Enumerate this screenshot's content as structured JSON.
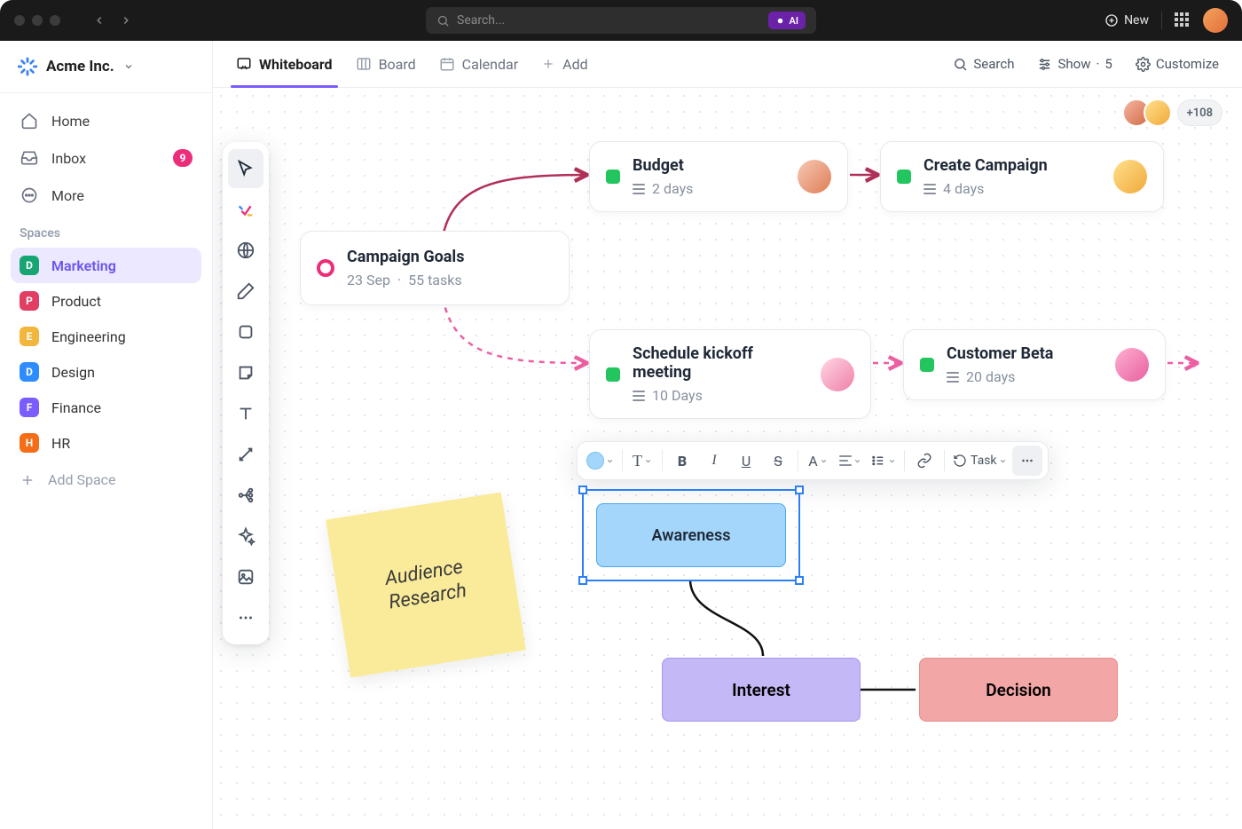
{
  "titlebar": {
    "search_placeholder": "Search...",
    "ai_label": "AI",
    "new_label": "New"
  },
  "workspace": {
    "name": "Acme Inc."
  },
  "sidebar": {
    "nav": {
      "home": "Home",
      "inbox": "Inbox",
      "inbox_count": "9",
      "more": "More"
    },
    "spaces_heading": "Spaces",
    "spaces": [
      {
        "letter": "D",
        "label": "Marketing",
        "color": "#17a673",
        "active": true
      },
      {
        "letter": "P",
        "label": "Product",
        "color": "#e23d63"
      },
      {
        "letter": "E",
        "label": "Engineering",
        "color": "#f2b63c"
      },
      {
        "letter": "D",
        "label": "Design",
        "color": "#2d8cff"
      },
      {
        "letter": "F",
        "label": "Finance",
        "color": "#7b5cff"
      },
      {
        "letter": "H",
        "label": "HR",
        "color": "#f56d17"
      }
    ],
    "add_space": "Add Space"
  },
  "views": {
    "whiteboard": "Whiteboard",
    "board": "Board",
    "calendar": "Calendar",
    "add": "Add",
    "search": "Search",
    "show": "Show",
    "show_count": "5",
    "customize": "Customize"
  },
  "presence": {
    "more": "+108"
  },
  "cards": {
    "goals": {
      "title": "Campaign Goals",
      "date": "23 Sep",
      "tasks": "55 tasks"
    },
    "budget": {
      "title": "Budget",
      "sub": "2 days"
    },
    "create": {
      "title": "Create Campaign",
      "sub": "4 days"
    },
    "kickoff": {
      "title": "Schedule kickoff meeting",
      "sub": "10 Days"
    },
    "beta": {
      "title": "Customer Beta",
      "sub": "20 days"
    }
  },
  "sticky": {
    "text": "Audience Research"
  },
  "shapes": {
    "awareness": "Awareness",
    "interest": "Interest",
    "decision": "Decision"
  },
  "format_toolbar": {
    "task": "Task",
    "text": "T",
    "bold": "B",
    "italic": "I",
    "underline": "U",
    "strike": "S",
    "font": "A"
  }
}
